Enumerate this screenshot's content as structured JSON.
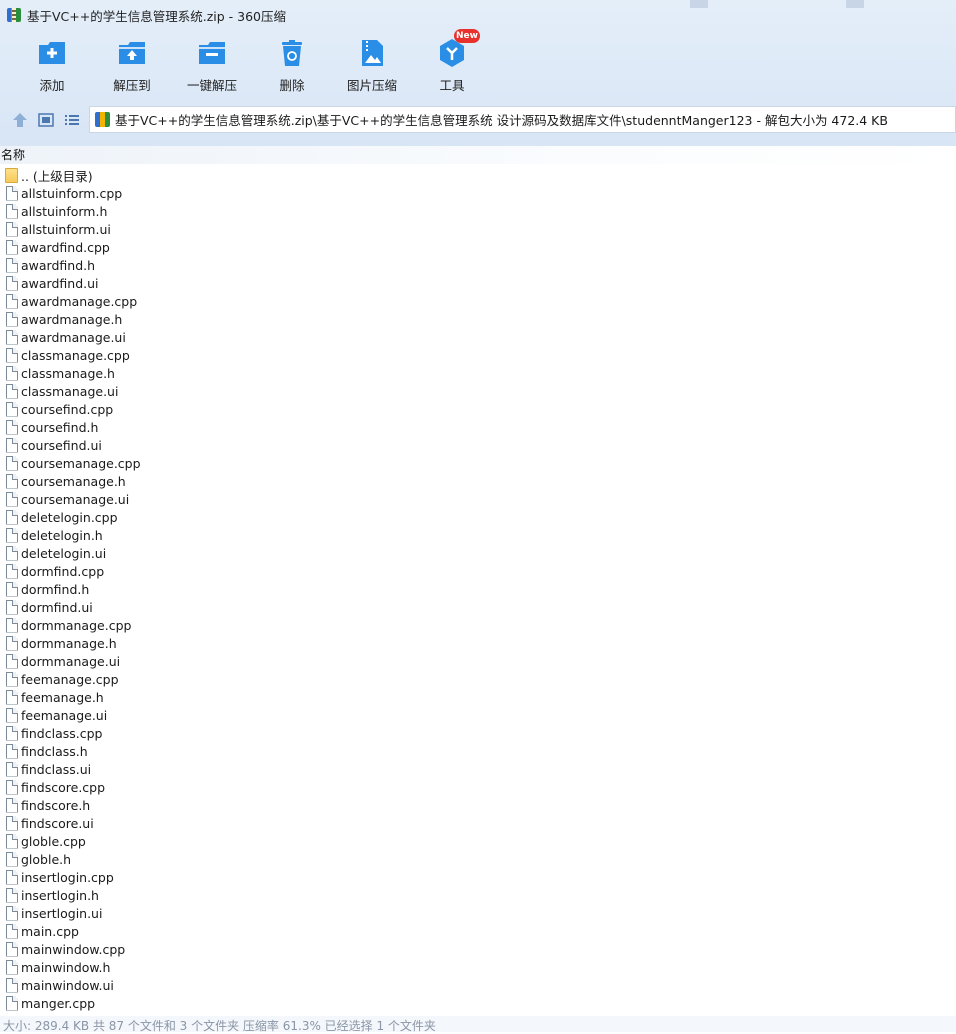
{
  "window": {
    "title": "基于VC++的学生信息管理系统.zip - 360压缩"
  },
  "toolbar": {
    "items": [
      {
        "label": "添加",
        "icon": "add-icon"
      },
      {
        "label": "解压到",
        "icon": "extract-to-icon"
      },
      {
        "label": "一键解压",
        "icon": "one-click-extract-icon"
      },
      {
        "label": "删除",
        "icon": "delete-icon"
      },
      {
        "label": "图片压缩",
        "icon": "image-compress-icon"
      },
      {
        "label": "工具",
        "icon": "tools-icon"
      }
    ],
    "badge": "New"
  },
  "address": {
    "path": "基于VC++的学生信息管理系统.zip\\基于VC++的学生信息管理系统 设计源码及数据库文件\\studenntManger123 - 解包大小为 472.4 KB"
  },
  "columns": {
    "name": "名称"
  },
  "files": [
    {
      "name": ".. (上级目录)",
      "type": "folder"
    },
    {
      "name": "allstuinform.cpp",
      "type": "file"
    },
    {
      "name": "allstuinform.h",
      "type": "file"
    },
    {
      "name": "allstuinform.ui",
      "type": "file"
    },
    {
      "name": "awardfind.cpp",
      "type": "file"
    },
    {
      "name": "awardfind.h",
      "type": "file"
    },
    {
      "name": "awardfind.ui",
      "type": "file"
    },
    {
      "name": "awardmanage.cpp",
      "type": "file"
    },
    {
      "name": "awardmanage.h",
      "type": "file"
    },
    {
      "name": "awardmanage.ui",
      "type": "file"
    },
    {
      "name": "classmanage.cpp",
      "type": "file"
    },
    {
      "name": "classmanage.h",
      "type": "file"
    },
    {
      "name": "classmanage.ui",
      "type": "file"
    },
    {
      "name": "coursefind.cpp",
      "type": "file"
    },
    {
      "name": "coursefind.h",
      "type": "file"
    },
    {
      "name": "coursefind.ui",
      "type": "file"
    },
    {
      "name": "coursemanage.cpp",
      "type": "file"
    },
    {
      "name": "coursemanage.h",
      "type": "file"
    },
    {
      "name": "coursemanage.ui",
      "type": "file"
    },
    {
      "name": "deletelogin.cpp",
      "type": "file"
    },
    {
      "name": "deletelogin.h",
      "type": "file"
    },
    {
      "name": "deletelogin.ui",
      "type": "file"
    },
    {
      "name": "dormfind.cpp",
      "type": "file"
    },
    {
      "name": "dormfind.h",
      "type": "file"
    },
    {
      "name": "dormfind.ui",
      "type": "file"
    },
    {
      "name": "dormmanage.cpp",
      "type": "file"
    },
    {
      "name": "dormmanage.h",
      "type": "file"
    },
    {
      "name": "dormmanage.ui",
      "type": "file"
    },
    {
      "name": "feemanage.cpp",
      "type": "file"
    },
    {
      "name": "feemanage.h",
      "type": "file"
    },
    {
      "name": "feemanage.ui",
      "type": "file"
    },
    {
      "name": "findclass.cpp",
      "type": "file"
    },
    {
      "name": "findclass.h",
      "type": "file"
    },
    {
      "name": "findclass.ui",
      "type": "file"
    },
    {
      "name": "findscore.cpp",
      "type": "file"
    },
    {
      "name": "findscore.h",
      "type": "file"
    },
    {
      "name": "findscore.ui",
      "type": "file"
    },
    {
      "name": "globle.cpp",
      "type": "file"
    },
    {
      "name": "globle.h",
      "type": "file"
    },
    {
      "name": "insertlogin.cpp",
      "type": "file"
    },
    {
      "name": "insertlogin.h",
      "type": "file"
    },
    {
      "name": "insertlogin.ui",
      "type": "file"
    },
    {
      "name": "main.cpp",
      "type": "file"
    },
    {
      "name": "mainwindow.cpp",
      "type": "file"
    },
    {
      "name": "mainwindow.h",
      "type": "file"
    },
    {
      "name": "mainwindow.ui",
      "type": "file"
    },
    {
      "name": "manger.cpp",
      "type": "file"
    }
  ],
  "status": {
    "text": "大小: 289.4 KB 共 87 个文件和 3 个文件夹 压缩率 61.3% 已经选择 1 个文件夹"
  },
  "colors": {
    "accent": "#2a8ee6",
    "header_bg": "#dde9f7",
    "badge": "#e8312c"
  }
}
